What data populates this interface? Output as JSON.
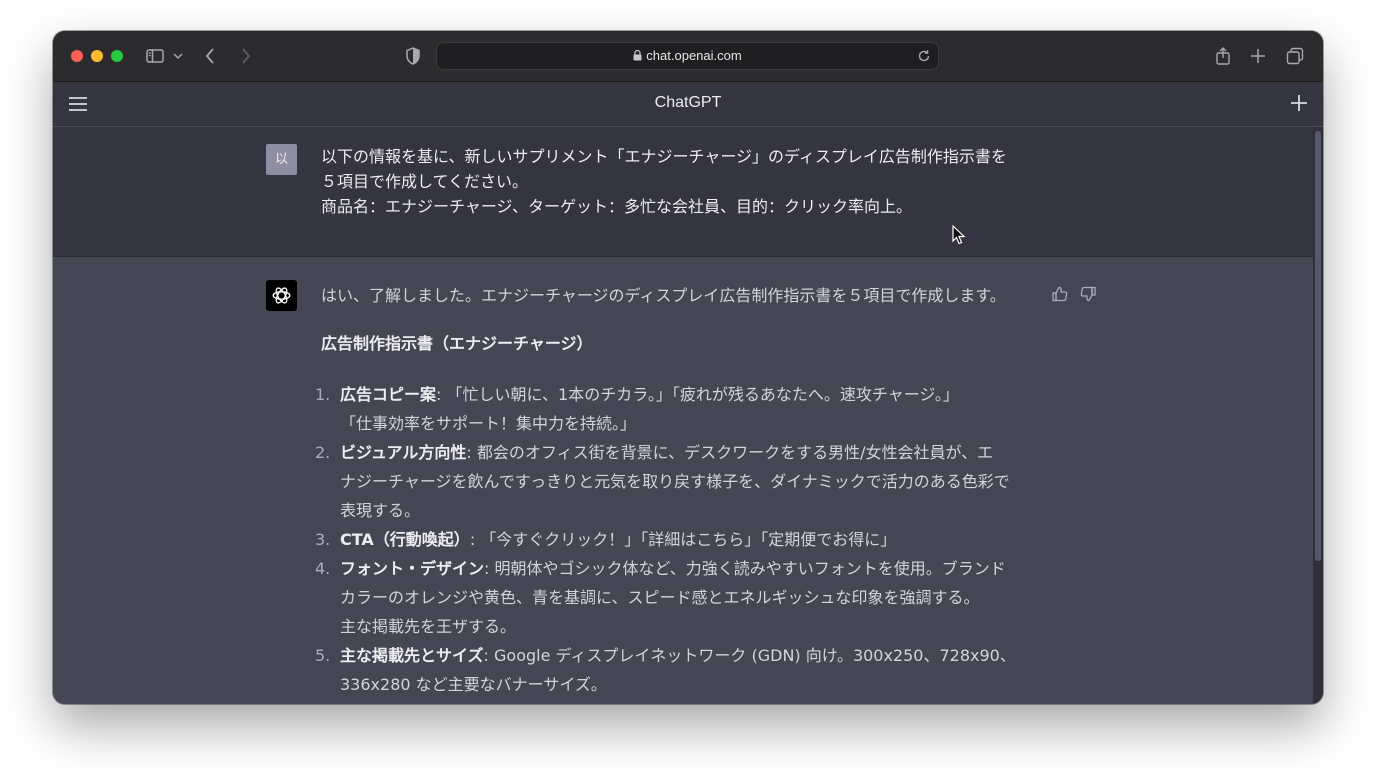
{
  "browser": {
    "url": "chat.openai.com",
    "icons": [
      "sidebar-icon",
      "chevron-down-icon",
      "back-icon",
      "forward-icon",
      "shield-icon",
      "lock-icon",
      "reload-icon",
      "share-icon",
      "new-tab-icon",
      "tabs-overview-icon"
    ]
  },
  "app": {
    "title": "ChatGPT"
  },
  "user_message": {
    "avatar": "以",
    "lines": [
      "以下の情報を基に、新しいサプリメント「エナジーチャージ」のディスプレイ広告制作指示書を",
      "５項目で作成してください。",
      "商品名：エナジーチャージ、ターゲット：多忙な会社員、目的：クリック率向上。"
    ]
  },
  "assistant_message": {
    "intro": "はい、了解しました。エナジーチャージのディスプレイ広告制作指示書を５項目で作成します。",
    "heading": "広告制作指示書（エナジーチャージ）",
    "items": [
      {
        "num": "1.",
        "title": "広告コピー案",
        "lines": [
          ": 「忙しい朝に、1本のチカラ。」「疲れが残るあなたへ。速攻チャージ。」",
          "「仕事効率をサポート！集中力を持続。」"
        ]
      },
      {
        "num": "2.",
        "title": "ビジュアル方向性",
        "lines": [
          ": 都会のオフィス街を背景に、デスクワークをする男性/女性会社員が、エ",
          "ナジーチャージを飲んですっきりと元気を取り戻す様子を、ダイナミックで活力のある色彩で",
          "表現する。"
        ]
      },
      {
        "num": "3.",
        "title": "CTA（行動喚起）",
        "lines": [
          ": 「今すぐクリック！」「詳細はこちら」「定期便でお得に」"
        ]
      },
      {
        "num": "4.",
        "title": "フォント・デザイン",
        "lines": [
          ": 明朝体やゴシック体など、力強く読みやすいフォントを使用。ブランド",
          "カラーのオレンジや黄色、青を基調に、スピード感とエネルギッシュな印象を強調する。",
          "主な掲載先を王ザする。"
        ]
      },
      {
        "num": "5.",
        "title": "主な掲載先とサイズ",
        "lines": [
          ": Google ディスプレイネットワーク (GDN) 向け。300x250、728x90、",
          "336x280 など主要なバナーサイズ。"
        ]
      }
    ]
  },
  "colors": {
    "background": "#343541",
    "assistant_background": "#444654",
    "text": "#ececf1"
  }
}
